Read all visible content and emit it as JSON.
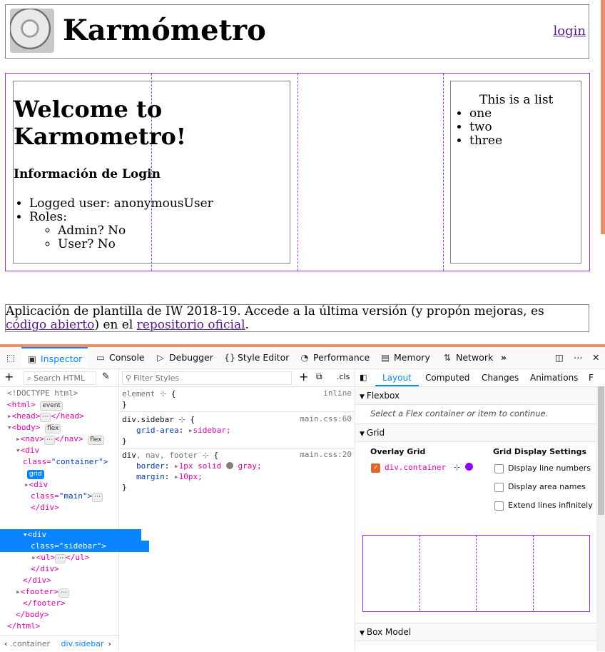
{
  "page": {
    "nav": {
      "title": "Karmómetro",
      "login_link": "login",
      "logo_icon": "compass-logo"
    },
    "main": {
      "welcome": "Welcome to Karmometro!",
      "login_header": "Información de Login",
      "logged_user": "Logged user: anonymousUser",
      "roles_label": "Roles:",
      "role_admin": "Admin? No",
      "role_user": "User? No"
    },
    "sidebar": {
      "title": "This is a list",
      "items": [
        "one",
        "two",
        "three"
      ]
    },
    "footer": {
      "text_1": "Aplicación de plantilla de IW 2018-19. Accede a la última versión (y propón mejoras, es ",
      "link_1": "código abierto",
      "text_2": ") en el ",
      "link_2": "repositorio oficial",
      "text_3": "."
    }
  },
  "devtools": {
    "tabs": [
      "Inspector",
      "Console",
      "Debugger",
      "Style Editor",
      "Performance",
      "Memory",
      "Network"
    ],
    "more_tabs": "»",
    "markup": {
      "search_placeholder": "Search HTML",
      "breadcrumbs": [
        ".container",
        "div.sidebar"
      ],
      "lines": {
        "doctype": "<!DOCTYPE html>",
        "html_open": "<html>",
        "html_badge": "event",
        "head": "<head>",
        "head_close": "</head>",
        "body_open": "<body>",
        "flex_badge": "flex",
        "nav_open": "<nav>",
        "nav_close": "</nav>",
        "div_open": "<div",
        "class_attr": "class=",
        "container_val": "\"container\">",
        "grid_badge": "grid",
        "main_val": "\"main\">",
        "div_close": "</div>",
        "sidebar_val": "\"sidebar\">",
        "ul_open": "<ul>",
        "ul_close": "</ul>",
        "footer_open": "<footer>",
        "footer_close": "</footer>",
        "body_close": "</body>",
        "html_close": "</html>",
        "ellipsis": "⋯"
      }
    },
    "rules": {
      "filter_placeholder": "Filter Styles",
      "cls": ".cls",
      "element_rule": "element",
      "inline": "inline",
      "sidebar_selector": "div.sidebar",
      "sidebar_file": "main.css:60",
      "grid_area_prop": "grid-area",
      "grid_area_val": "sidebar;",
      "common_selector_1": "div",
      "common_selector_2": ", nav, footer",
      "common_file": "main.css:20",
      "border_prop": "border",
      "border_val_1": "1px solid",
      "border_val_2": "gray;",
      "margin_prop": "margin",
      "margin_val": "10px;",
      "open_brace": "{",
      "close_brace": "}"
    },
    "layout": {
      "tabs": [
        "Layout",
        "Computed",
        "Changes",
        "Animations",
        "F"
      ],
      "flexbox_header": "Flexbox",
      "flexbox_hint": "Select a Flex container or item to continue.",
      "grid_header": "Grid",
      "overlay_grid_label": "Overlay Grid",
      "overlay_item": "div.container",
      "overlay_color": "#9400ff",
      "grid_display_settings": "Grid Display Settings",
      "options": [
        "Display line numbers",
        "Display area names",
        "Extend lines infinitely"
      ],
      "box_model_header": "Box Model"
    }
  }
}
